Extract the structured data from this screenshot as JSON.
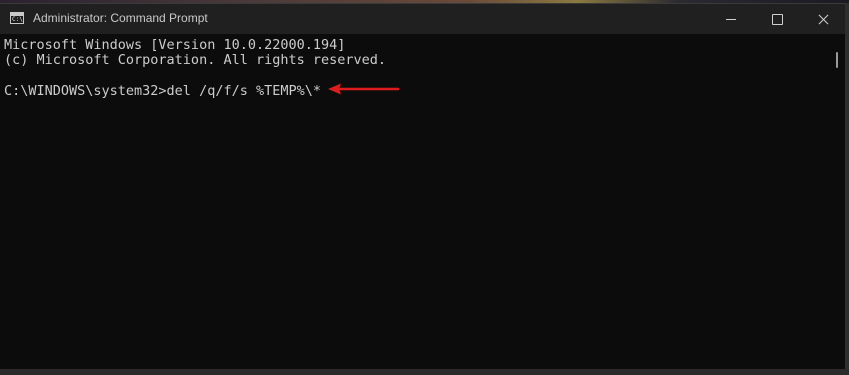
{
  "window": {
    "title": "Administrator: Command Prompt",
    "icon": "cmd-icon",
    "icon_glyph": "C:\\",
    "controls": {
      "minimize": "minimize-icon",
      "maximize": "maximize-icon",
      "close": "close-icon"
    }
  },
  "console": {
    "lines": [
      "Microsoft Windows [Version 10.0.22000.194]",
      "(c) Microsoft Corporation. All rights reserved.",
      "C:\\WINDOWS\\system32>del /q/f/s %TEMP%\\*"
    ],
    "colors": {
      "background": "#0c0c0c",
      "text": "#cccccc"
    }
  },
  "annotation": {
    "icon": "arrow-left-icon",
    "color": "#e01b1b"
  }
}
